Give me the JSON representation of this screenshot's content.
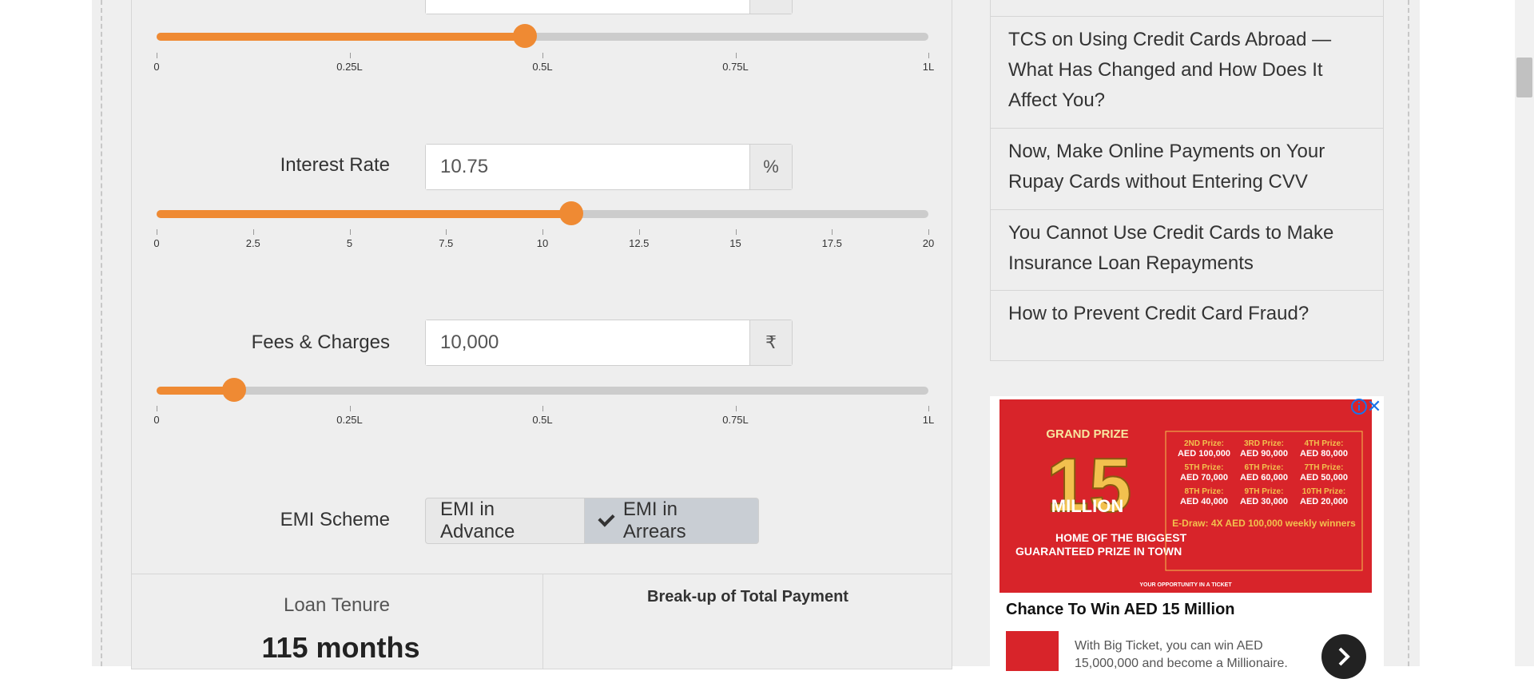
{
  "loan_amount_slider": {
    "ticks": [
      "0",
      "0.25L",
      "0.5L",
      "0.75L",
      "1L"
    ],
    "value_fraction": 0.477
  },
  "interest_rate": {
    "label": "Interest Rate",
    "value": "10.75",
    "unit": "%",
    "ticks": [
      "0",
      "2.5",
      "5",
      "7.5",
      "10",
      "12.5",
      "15",
      "17.5",
      "20"
    ],
    "value_fraction": 0.5375
  },
  "fees_charges": {
    "label": "Fees & Charges",
    "value": "10,000",
    "unit": "₹",
    "ticks": [
      "0",
      "0.25L",
      "0.5L",
      "0.75L",
      "1L"
    ],
    "value_fraction": 0.1
  },
  "emi_scheme": {
    "label": "EMI Scheme",
    "options": [
      "EMI in Advance",
      "EMI in Arrears"
    ],
    "selected": "EMI in Arrears"
  },
  "results": {
    "tenure_label": "Loan Tenure",
    "tenure_value": "115 months",
    "breakup_title": "Break-up of Total Payment"
  },
  "sidebar": {
    "items": [
      "TCS on Using Credit Cards Abroad — What Has Changed and How Does It Affect You?",
      "Now, Make Online Payments on Your Rupay Cards without Entering CVV",
      "You Cannot Use Credit Cards to Make Insurance Loan Repayments",
      "How to Prevent Credit Card Fraud?"
    ]
  },
  "ad": {
    "headline": "Chance To Win AED 15 Million",
    "body": "With Big Ticket, you can win AED 15,000,000 and become a Millionaire.",
    "image_text": {
      "grand_prize": "GRAND PRIZE",
      "amount": "15",
      "million": "MILLION",
      "tagline": "HOME OF THE BIGGEST GUARANTEED PRIZE IN TOWN",
      "prizes": [
        [
          "2ND Prize:",
          "AED 100,000"
        ],
        [
          "3RD Prize:",
          "AED 90,000"
        ],
        [
          "4TH Prize:",
          "AED 80,000"
        ],
        [
          "5TH Prize:",
          "AED 70,000"
        ],
        [
          "6TH Prize:",
          "AED 60,000"
        ],
        [
          "7TH Prize:",
          "AED 50,000"
        ],
        [
          "8TH Prize:",
          "AED 40,000"
        ],
        [
          "9TH Prize:",
          "AED 30,000"
        ],
        [
          "10TH Prize:",
          "AED 20,000"
        ]
      ],
      "edraw": "E-Draw: 4X AED 100,000 weekly winners",
      "footer": "YOUR OPPORTUNITY IN A TICKET"
    },
    "colors": {
      "ad_red": "#d8242a",
      "gold": "#f2c14e"
    }
  },
  "colors": {
    "accent": "#ef8a33",
    "track": "#cccccc",
    "panel": "#eeeeee"
  }
}
